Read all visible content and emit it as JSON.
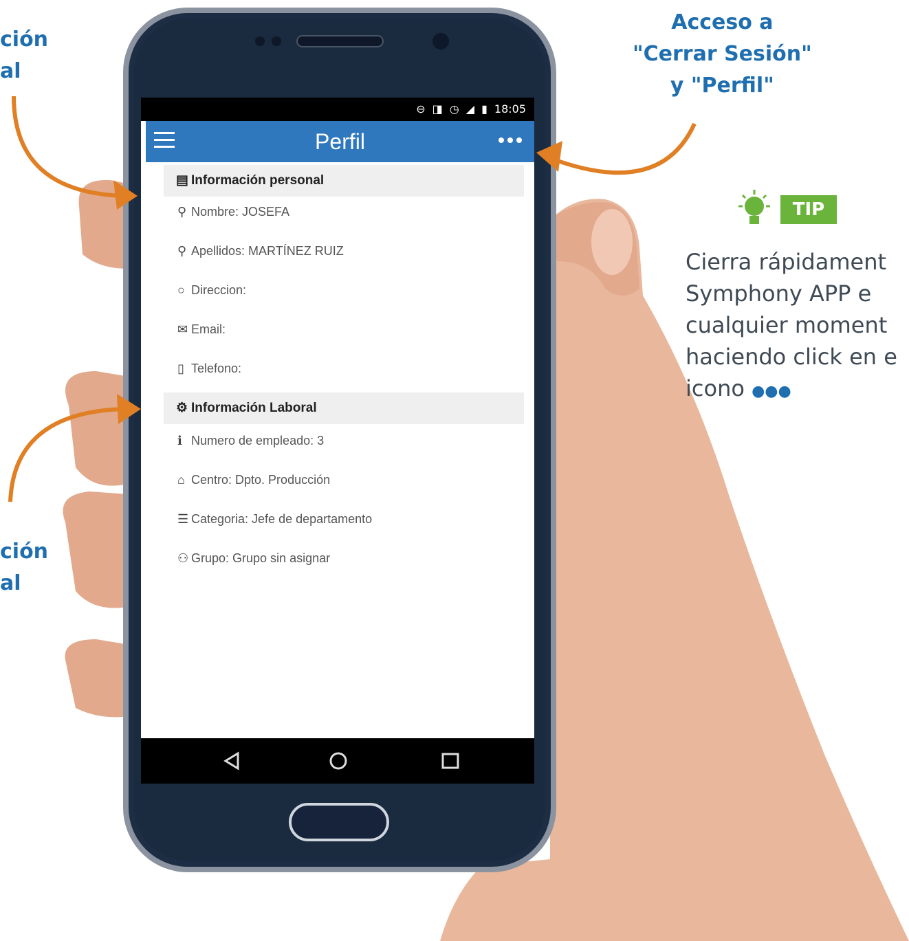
{
  "callouts": {
    "personal": "ción\nal",
    "laboral": "ción\nal",
    "session": "Acceso a\n\"Cerrar Sesión\"\ny \"Perfil\""
  },
  "tip": {
    "badge": "TIP",
    "lines": [
      "Cierra    rápidament",
      "Symphony   APP   e",
      "cualquier   moment",
      "haciendo  click  en  e",
      "icono"
    ],
    "icon_symbol": "●●●",
    "accent_color": "#6ab43c",
    "callout_color": "#1f6fb0"
  },
  "status_bar": {
    "time": "18:05",
    "icons": [
      "do-not-disturb-icon",
      "vibrate-icon",
      "alarm-icon",
      "signal-icon",
      "battery-icon"
    ]
  },
  "app_bar": {
    "title": "Perfil",
    "color": "#2f78bd"
  },
  "personal_section": {
    "header": "Información personal",
    "rows": [
      {
        "icon": "user-icon",
        "text": "Nombre: JOSEFA"
      },
      {
        "icon": "user-icon",
        "text": "Apellidos: MARTÍNEZ RUIZ"
      },
      {
        "icon": "location-icon",
        "text": "Direccion:"
      },
      {
        "icon": "email-icon",
        "text": "Email:"
      },
      {
        "icon": "phone-icon",
        "text": "Telefono:"
      }
    ]
  },
  "work_section": {
    "header": "Información Laboral",
    "rows": [
      {
        "icon": "info-icon",
        "text": "Numero de empleado: 3"
      },
      {
        "icon": "home-icon",
        "text": "Centro: Dpto. Producción"
      },
      {
        "icon": "category-icon",
        "text": "Categoria: Jefe de departamento"
      },
      {
        "icon": "group-icon",
        "text": "Grupo: Grupo sin asignar"
      }
    ]
  }
}
